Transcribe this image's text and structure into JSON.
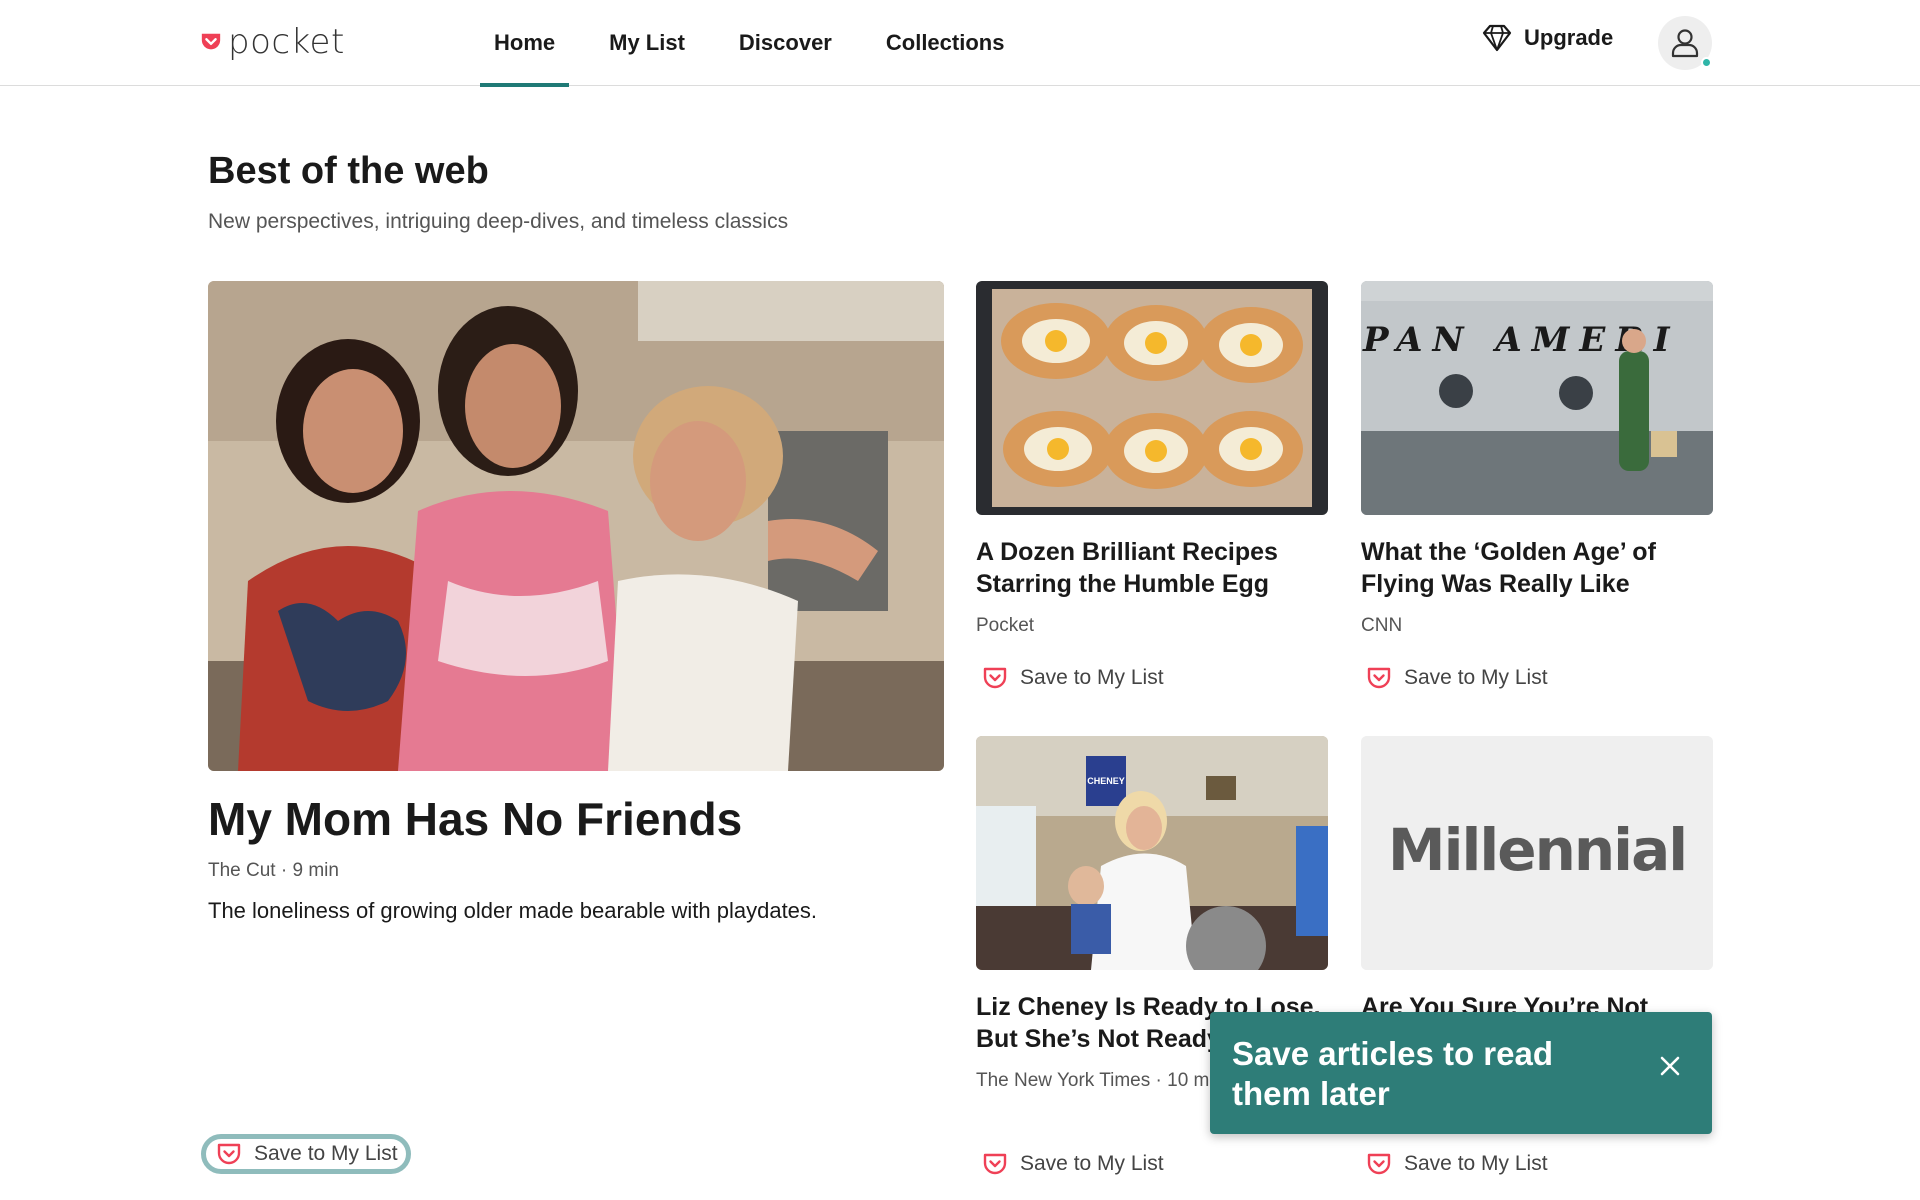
{
  "header": {
    "logo_text": "pocket",
    "nav": [
      {
        "label": "Home",
        "active": true
      },
      {
        "label": "My List",
        "active": false
      },
      {
        "label": "Discover",
        "active": false
      },
      {
        "label": "Collections",
        "active": false
      }
    ],
    "upgrade_label": "Upgrade",
    "accent_color": "#1f7a76",
    "brand_color": "#ef4056"
  },
  "section": {
    "title": "Best of the web",
    "subtitle": "New perspectives, intriguing deep-dives, and timeless classics"
  },
  "hero": {
    "title": "My Mom Has No Friends",
    "meta": "The Cut · 9 min",
    "excerpt": "The loneliness of growing older made bearable with playdates.",
    "save_label": "Save to My List"
  },
  "cards": [
    {
      "title": "A Dozen Brilliant Recipes Starring the Humble Egg",
      "source": "Pocket",
      "save_label": "Save to My List"
    },
    {
      "title": "What the ‘Golden Age’ of Flying Was Really Like",
      "source": "CNN",
      "save_label": "Save to My List"
    },
    {
      "title": "Liz Cheney Is Ready to Lose. But She’s Not Ready",
      "source": "The New York Times · 10 m",
      "save_label": "Save to My List"
    },
    {
      "title": "Are You Sure You’re Not",
      "source": "",
      "save_label": "Save to My List",
      "image_text": "Millennial"
    }
  ],
  "images": {
    "plane_text": "PAN AMERI",
    "sign_text": "CHENEY"
  },
  "toast": {
    "text": "Save articles to read them later",
    "color": "#2e7d78"
  }
}
